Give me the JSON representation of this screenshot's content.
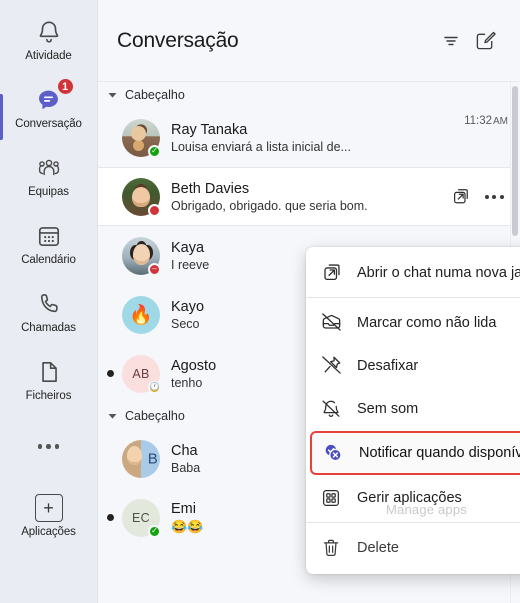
{
  "rail": {
    "items": [
      {
        "label": "Atividade",
        "icon": "bell-icon",
        "badge": null,
        "active": false
      },
      {
        "label": "Conversação",
        "icon": "chat-icon",
        "badge": "1",
        "active": true
      },
      {
        "label": "Equipas",
        "icon": "people-icon",
        "badge": null,
        "active": false
      },
      {
        "label": "Calendário",
        "icon": "calendar-icon",
        "badge": null,
        "active": false
      },
      {
        "label": "Chamadas",
        "icon": "phone-icon",
        "badge": null,
        "active": false
      },
      {
        "label": "Ficheiros",
        "icon": "file-icon",
        "badge": null,
        "active": false
      },
      {
        "label": "",
        "icon": "more-icon",
        "badge": null,
        "active": false
      },
      {
        "label": "Aplicações",
        "icon": "apps-plus-icon",
        "badge": null,
        "active": false
      }
    ],
    "accent_color": "#5b5fc7",
    "badge_color": "#d13438"
  },
  "header": {
    "title": "Conversação",
    "filter_icon": "filter-icon",
    "compose_icon": "compose-icon"
  },
  "list": {
    "groups": [
      {
        "label": "Cabeçalho",
        "rows": [
          {
            "name": "Ray Tanaka",
            "preview": "Louisa enviará a lista inicial de...",
            "time": "11:32",
            "time_suffix": "AM",
            "presence": "available",
            "unread": false,
            "selected": false,
            "avatar_kind": "photo",
            "avatar_class": "ph-ray",
            "initials": ""
          },
          {
            "name": "Beth Davies",
            "preview": "Obrigado, obrigado. que seria bom.",
            "time": "",
            "time_suffix": "",
            "presence": "busy",
            "unread": false,
            "selected": true,
            "avatar_kind": "photo",
            "avatar_class": "ph-beth",
            "initials": ""
          },
          {
            "name": "Kaya",
            "preview": "I reeve",
            "time": "",
            "time_suffix": "",
            "presence": "busy",
            "unread": false,
            "selected": false,
            "avatar_kind": "photo",
            "avatar_class": "ph-kaya",
            "initials": ""
          },
          {
            "name": "Kayo",
            "preview": "Seco",
            "time": "",
            "time_suffix": "",
            "presence": "none",
            "unread": false,
            "selected": false,
            "avatar_kind": "emoji",
            "avatar_class": "ph-kayo",
            "initials": "🔥"
          },
          {
            "name": "Agosto",
            "preview": "tenho",
            "time": "",
            "time_suffix": "",
            "presence": "away",
            "unread": true,
            "selected": false,
            "avatar_kind": "initials",
            "avatar_class": "ph-ab",
            "initials": "AB"
          }
        ]
      },
      {
        "label": "Cabeçalho",
        "rows": [
          {
            "name": "Cha",
            "preview": "Baba",
            "time": "",
            "time_suffix": "",
            "presence": "none",
            "unread": false,
            "selected": false,
            "avatar_kind": "split",
            "avatar_class": "ph-cha",
            "initials": "B"
          },
          {
            "name": "Emi",
            "preview": "😂😂",
            "time": "",
            "time_suffix": "",
            "presence": "available",
            "unread": true,
            "selected": false,
            "avatar_kind": "initials",
            "avatar_class": "ph-ec",
            "initials": "EC"
          }
        ]
      }
    ],
    "row_actions": {
      "popout_icon": "open-in-new-window-icon",
      "more_icon": "more-options-icon"
    }
  },
  "context_menu": {
    "items": [
      {
        "label": "Abrir o chat numa nova janela",
        "icon": "open-in-new-window-icon",
        "highlighted": false,
        "separator_after": true,
        "ghost": ""
      },
      {
        "label": "Marcar como não lida",
        "icon": "mark-unread-icon",
        "highlighted": false,
        "separator_after": false,
        "ghost": ""
      },
      {
        "label": "Desafixar",
        "icon": "unpin-icon",
        "highlighted": false,
        "separator_after": false,
        "ghost": ""
      },
      {
        "label": "Sem som",
        "icon": "mute-icon",
        "highlighted": false,
        "separator_after": false,
        "ghost": ""
      },
      {
        "label": "Notificar quando disponível",
        "icon": "notify-when-available-icon",
        "highlighted": true,
        "separator_after": false,
        "ghost": ""
      },
      {
        "label": "Gerir aplicações",
        "icon": "manage-apps-icon",
        "highlighted": false,
        "separator_after": true,
        "ghost": "Manage apps"
      },
      {
        "label": "Delete",
        "icon": "trash-icon",
        "highlighted": false,
        "separator_after": false,
        "ghost": ""
      }
    ],
    "highlight_color": "#e8413c"
  }
}
